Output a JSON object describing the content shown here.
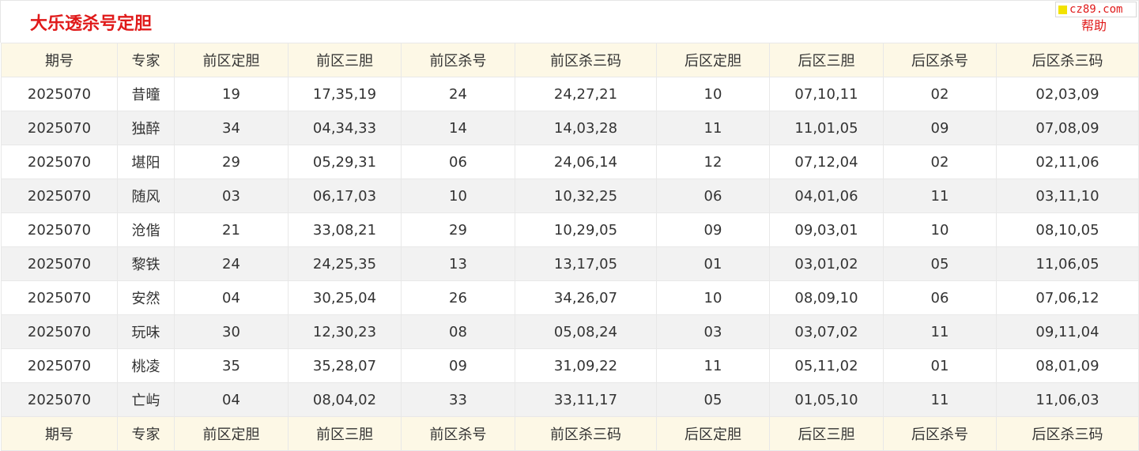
{
  "header": {
    "title": "大乐透杀号定胆",
    "site_badge": "cz89.com",
    "help_label": "帮助"
  },
  "colors": {
    "accent_red": "#e01a1a",
    "header_bg": "#fdf8e6",
    "zebra_bg": "#f2f2f2",
    "badge_square": "#f2e200"
  },
  "table": {
    "columns": [
      "期号",
      "专家",
      "前区定胆",
      "前区三胆",
      "前区杀号",
      "前区杀三码",
      "后区定胆",
      "后区三胆",
      "后区杀号",
      "后区杀三码"
    ],
    "rows": [
      [
        "2025070",
        "昔曈",
        "19",
        "17,35,19",
        "24",
        "24,27,21",
        "10",
        "07,10,11",
        "02",
        "02,03,09"
      ],
      [
        "2025070",
        "独醉",
        "34",
        "04,34,33",
        "14",
        "14,03,28",
        "11",
        "11,01,05",
        "09",
        "07,08,09"
      ],
      [
        "2025070",
        "堪阳",
        "29",
        "05,29,31",
        "06",
        "24,06,14",
        "12",
        "07,12,04",
        "02",
        "02,11,06"
      ],
      [
        "2025070",
        "随风",
        "03",
        "06,17,03",
        "10",
        "10,32,25",
        "06",
        "04,01,06",
        "11",
        "03,11,10"
      ],
      [
        "2025070",
        "沧偕",
        "21",
        "33,08,21",
        "29",
        "10,29,05",
        "09",
        "09,03,01",
        "10",
        "08,10,05"
      ],
      [
        "2025070",
        "黎铁",
        "24",
        "24,25,35",
        "13",
        "13,17,05",
        "01",
        "03,01,02",
        "05",
        "11,06,05"
      ],
      [
        "2025070",
        "安然",
        "04",
        "30,25,04",
        "26",
        "34,26,07",
        "10",
        "08,09,10",
        "06",
        "07,06,12"
      ],
      [
        "2025070",
        "玩味",
        "30",
        "12,30,23",
        "08",
        "05,08,24",
        "03",
        "03,07,02",
        "11",
        "09,11,04"
      ],
      [
        "2025070",
        "桃凌",
        "35",
        "35,28,07",
        "09",
        "31,09,22",
        "11",
        "05,11,02",
        "01",
        "08,01,09"
      ],
      [
        "2025070",
        "亡屿",
        "04",
        "08,04,02",
        "33",
        "33,11,17",
        "05",
        "01,05,10",
        "11",
        "11,06,03"
      ]
    ]
  }
}
